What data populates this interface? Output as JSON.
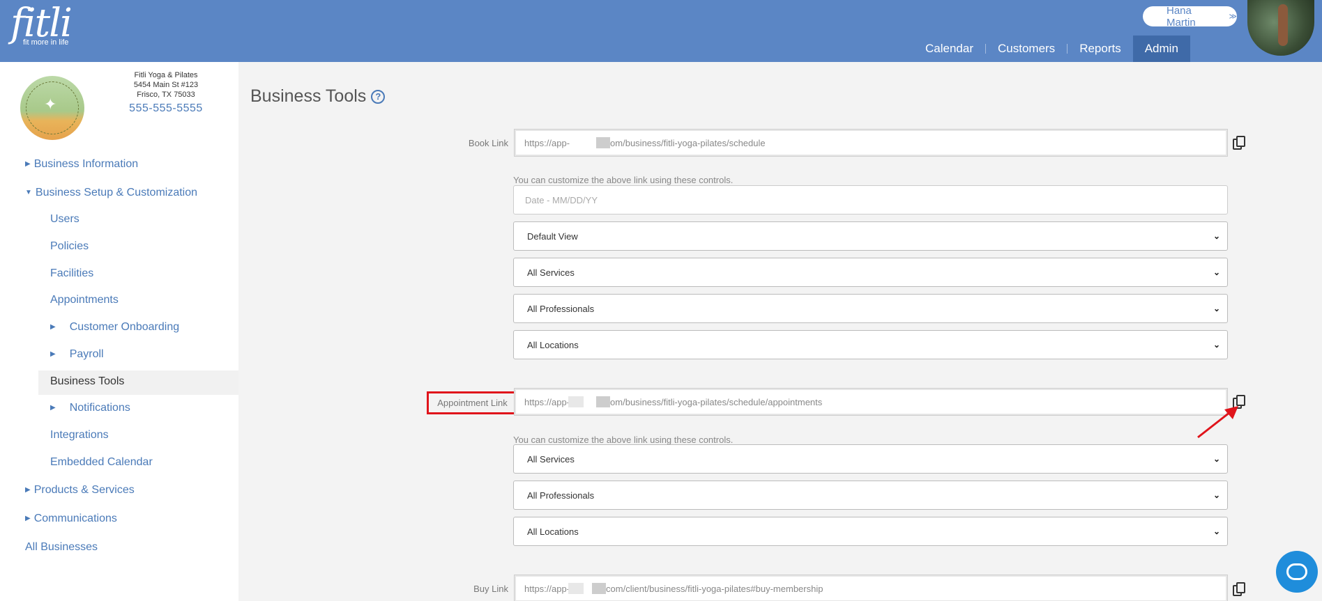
{
  "header": {
    "logo_text": "fitli",
    "logo_tagline": "fit more in life",
    "user_name": "Hana Martin",
    "nav": [
      {
        "label": "Calendar"
      },
      {
        "label": "Customers"
      },
      {
        "label": "Reports"
      },
      {
        "label": "Admin",
        "active": true
      }
    ]
  },
  "business": {
    "name": "Fitli Yoga & Pilates",
    "address1": "5454 Main St #123",
    "address2": "Frisco, TX 75033",
    "phone": "555-555-5555"
  },
  "sidebar": {
    "items": [
      {
        "label": "Business Information"
      },
      {
        "label": "Business Setup & Customization"
      },
      {
        "label": "Users"
      },
      {
        "label": "Policies"
      },
      {
        "label": "Facilities"
      },
      {
        "label": "Appointments"
      },
      {
        "label": "Customer Onboarding"
      },
      {
        "label": "Payroll"
      },
      {
        "label": "Business Tools"
      },
      {
        "label": "Notifications"
      },
      {
        "label": "Integrations"
      },
      {
        "label": "Embedded Calendar"
      },
      {
        "label": "Products & Services"
      },
      {
        "label": "Communications"
      },
      {
        "label": "All Businesses"
      }
    ]
  },
  "main": {
    "title": "Business Tools",
    "help_glyph": "?",
    "book": {
      "label": "Book Link",
      "url_prefix": "https://app-",
      "url_suffix": "om/business/fitli-yoga-pilates/schedule",
      "hint": "You can customize the above link using these controls.",
      "date_placeholder": "Date - MM/DD/YY",
      "selects": [
        "Default View",
        "All Services",
        "All Professionals",
        "All Locations"
      ]
    },
    "appointment": {
      "label": "Appointment Link",
      "url_prefix": "https://app-",
      "url_suffix": "om/business/fitli-yoga-pilates/schedule/appointments",
      "hint": "You can customize the above link using these controls.",
      "selects": [
        "All Services",
        "All Professionals",
        "All Locations"
      ]
    },
    "buy": {
      "label": "Buy Link",
      "url_prefix": "https://app-",
      "url_suffix": "com/client/business/fitli-yoga-pilates#buy-membership"
    }
  },
  "colors": {
    "header_bg": "#5b86c5",
    "nav_active_bg": "#3f6aa8",
    "link": "#4a7ab8",
    "highlight": "#e0141b",
    "chat": "#1f8ddb"
  },
  "icons": [
    "help-icon",
    "copy-icon",
    "chat-icon",
    "chevron-down-icon",
    "caret-right-icon",
    "caret-down-icon"
  ]
}
